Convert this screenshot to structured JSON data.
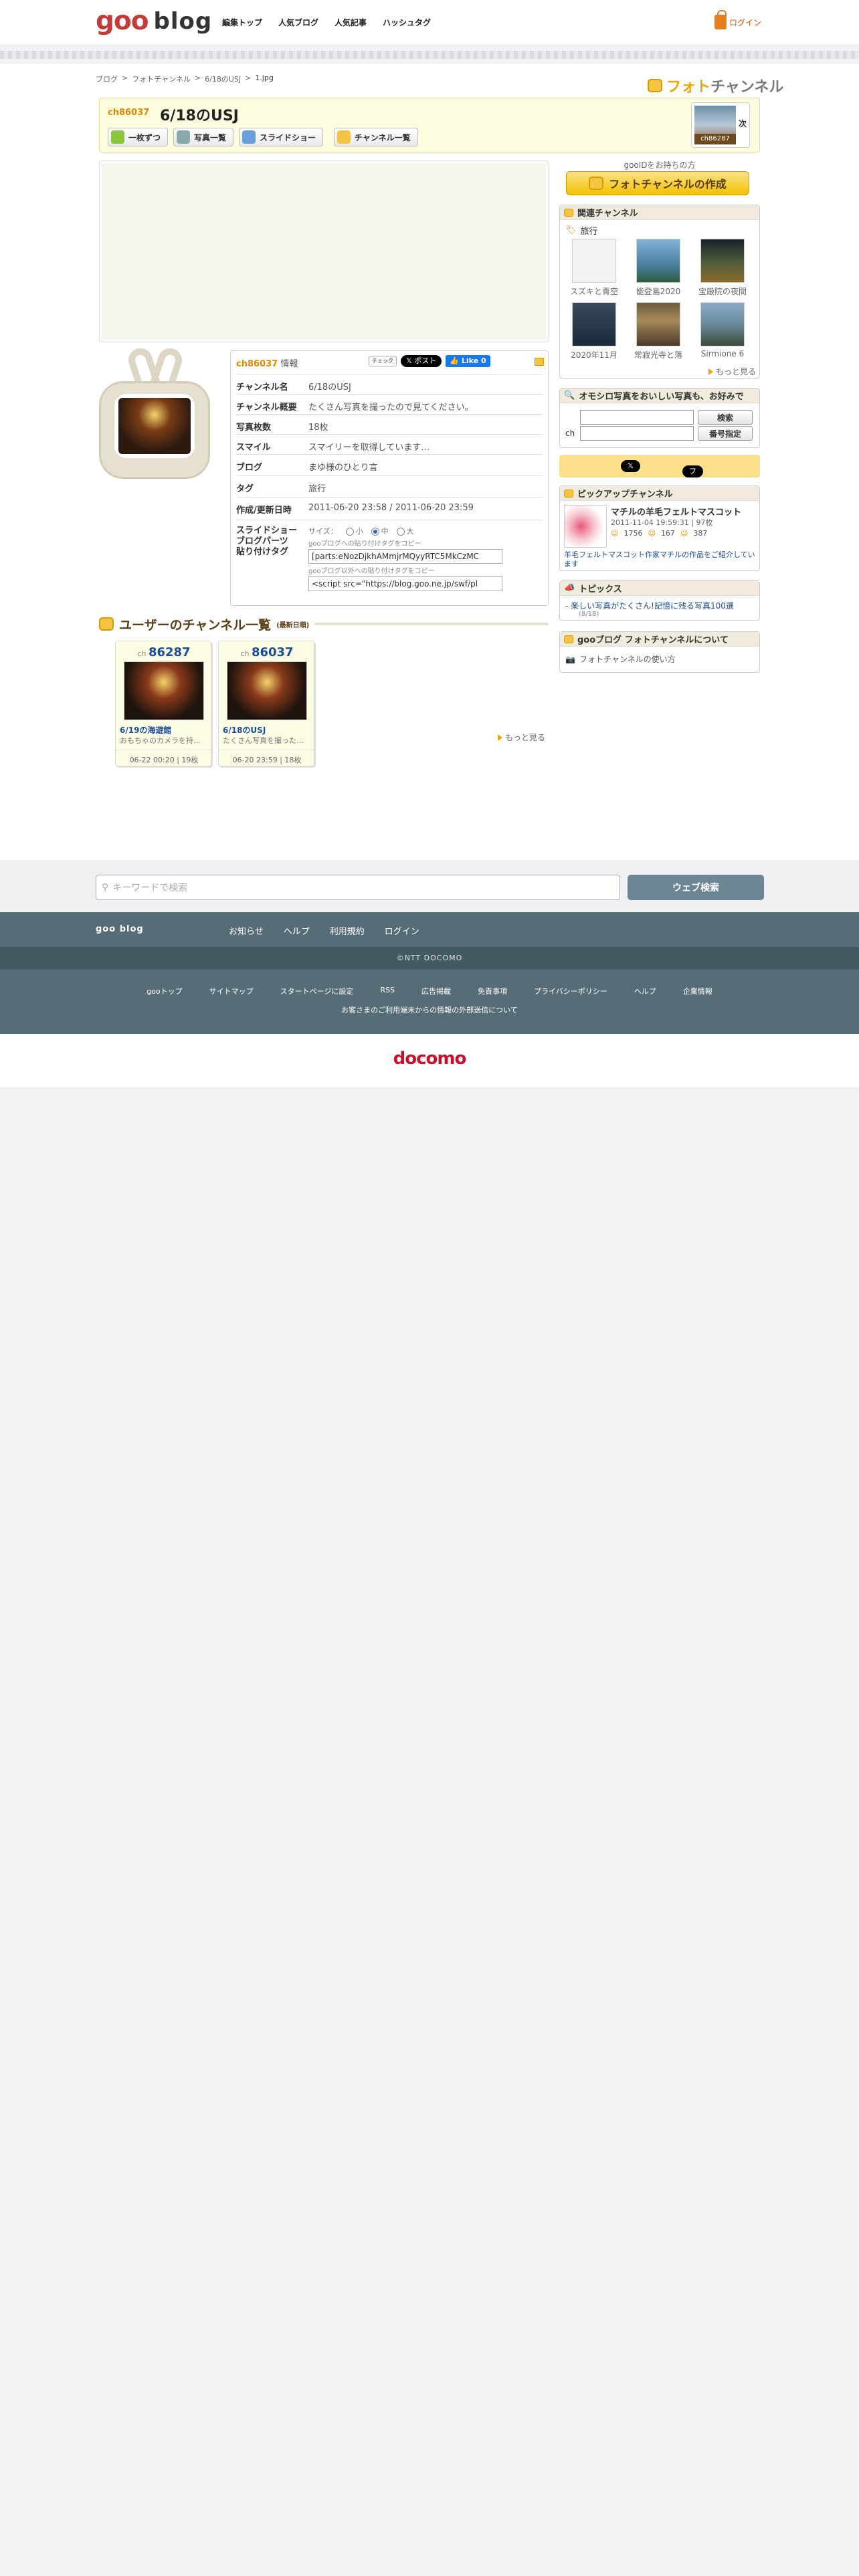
{
  "header": {
    "logo_goo": "goo",
    "logo_blog": "blog",
    "nav": [
      "編集トップ",
      "人気ブログ",
      "人気記事",
      "ハッシュタグ"
    ],
    "login": "ログイン"
  },
  "breadcrumb": [
    "ブログ",
    "フォトチャンネル",
    "6/18のUSJ",
    "1.jpg"
  ],
  "brand": {
    "photo": "フォト",
    "channel": "チャンネル"
  },
  "channel": {
    "number": "ch86037",
    "title": "6/18のUSJ",
    "buttons": [
      "一枚ずつ",
      "写真一覧",
      "スライドショー",
      "チャンネル一覧"
    ],
    "next_label": "次",
    "next_ch": "ch86287"
  },
  "info": {
    "head_ch": "ch86037",
    "head_label": "情報",
    "check": "チェック",
    "post": "ポスト",
    "like": "Like 0",
    "rows": [
      {
        "k": "チャンネル名",
        "v": "6/18のUSJ"
      },
      {
        "k": "チャンネル概要",
        "v": "たくさん写真を撮ったので見てください。"
      },
      {
        "k": "写真枚数",
        "v": "18枚"
      },
      {
        "k": "スマイル",
        "v": "スマイリーを取得しています…"
      },
      {
        "k": "ブログ",
        "v": "まゆ様のひとり言"
      },
      {
        "k": "タグ",
        "v": "旅行"
      },
      {
        "k": "作成/更新日時",
        "v": "2011-06-20 23:58 / 2011-06-20 23:59"
      }
    ],
    "slideshow_k": "スライドショー\nブログパーツ\n貼り付けタグ",
    "size_label": "サイズ：",
    "sizes": [
      "小",
      "中",
      "大"
    ],
    "selected_size": "中",
    "copy1": "gooブログへの貼り付けタグをコピー",
    "code1": "[parts:eNozDjkhAMmjrMQyyRTC5MkCzMC",
    "copy2": "gooブログ以外への貼り付けタグをコピー",
    "code2": "<script src=\"https://blog.goo.ne.jp/swf/pl"
  },
  "userlist": {
    "title": "ユーザーのチャンネル一覧",
    "sub": "(最新日順)",
    "cards": [
      {
        "ch": "ch",
        "no": "86287",
        "name": "6/19の海遊館",
        "desc": "おもちゃのカメラを持…",
        "date": "06-22 00:20 | 19枚"
      },
      {
        "ch": "ch",
        "no": "86037",
        "name": "6/18のUSJ",
        "desc": "たくさん写真を撮った…",
        "date": "06-20 23:59 | 18枚"
      }
    ],
    "more": "もっと見る"
  },
  "right": {
    "goo_id": "gooIDをお持ちの方",
    "create": "フォトチャンネルの作成",
    "related_title": "関連チャンネル",
    "related_tag": "旅行",
    "related": [
      "スズキと青空",
      "能登島2020",
      "宝厳院の夜間",
      "2020年11月",
      "常寂光寺と落",
      "Sirmione 6"
    ],
    "related_more": "もっと見る",
    "search_title": "オモシロ写真をおいしい写真も、お好みで",
    "search_btn": "検索",
    "ch_label": "ch",
    "ch_btn": "番号指定",
    "follow": "フォローする",
    "pickup_title": "ピックアップチャンネル",
    "pickup_name": "マチルの羊毛フェルトマスコット",
    "pickup_meta": "2011-11-04 19:59:31 | 97枚",
    "pickup_counts": [
      "1756",
      "167",
      "387"
    ],
    "pickup_desc": "羊毛フェルトマスコット作家マチルの作品をご紹介しています",
    "topics_title": "トピックス",
    "topics_item": "楽しい写真がたくさん!記憶に残る写真100選",
    "topics_date": "(8/18)",
    "about_title": "gooブログ フォトチャンネルについて",
    "about_link": "フォトチャンネルの使い方"
  },
  "footer": {
    "search_placeholder": "キーワードで検索",
    "web_search": "ウェブ検索",
    "brand": "goo blog",
    "links1": [
      "お知らせ",
      "ヘルプ",
      "利用規約",
      "ログイン"
    ],
    "copyright": "©NTT DOCOMO",
    "links2": [
      "gooトップ",
      "サイトマップ",
      "スタートページに設定",
      "RSS",
      "広告掲載",
      "免責事項",
      "プライバシーポリシー",
      "ヘルプ",
      "企業情報"
    ],
    "note": "お客さまのご利用端末からの情報の外部送信について",
    "docomo": "docomo"
  },
  "colors": {
    "accent": "#f0a500",
    "link": "#1a4d96",
    "footer": "#566d77",
    "docomo": "#c8102e"
  }
}
